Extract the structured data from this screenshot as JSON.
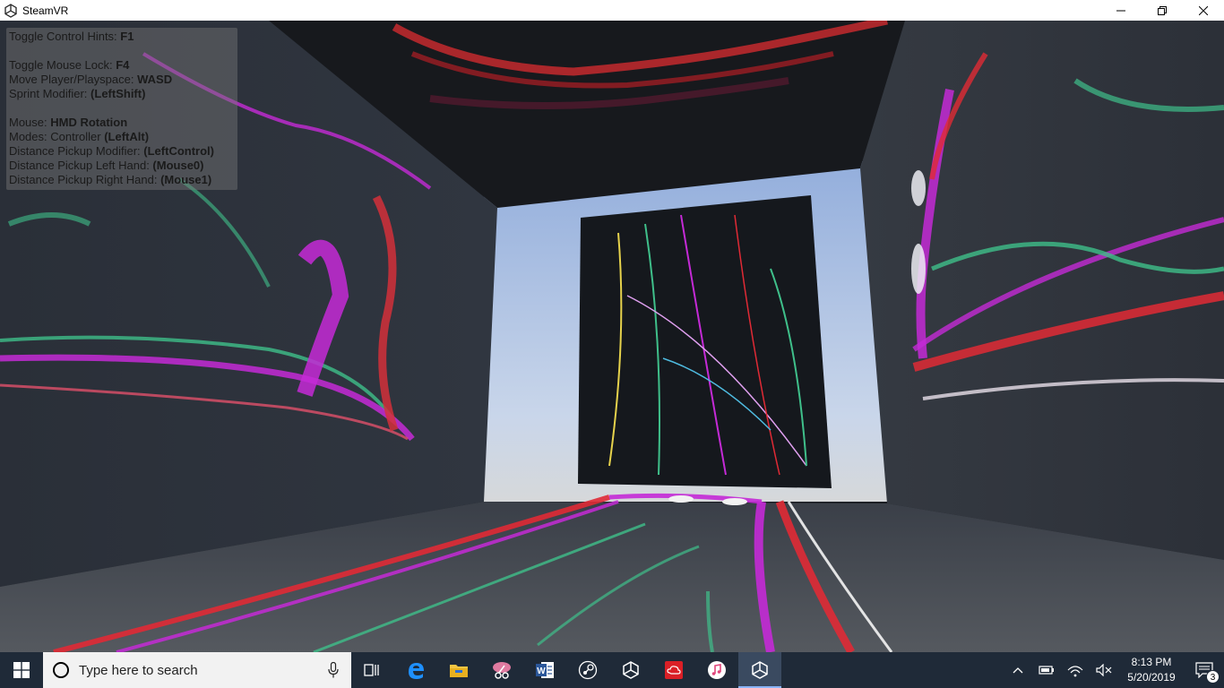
{
  "window": {
    "title": "SteamVR"
  },
  "hints": {
    "lines": [
      {
        "label": "Toggle Control Hints: ",
        "key": "F1"
      },
      {
        "label": "Toggle Mouse Lock: ",
        "key": "F4"
      },
      {
        "label": "Move Player/Playspace: ",
        "key": "WASD"
      },
      {
        "label": "Sprint Modifier: ",
        "key": "(LeftShift)"
      },
      {
        "label": "Mouse: ",
        "key": "HMD Rotation"
      },
      {
        "label": "Modes: Controller ",
        "key": "(LeftAlt)"
      },
      {
        "label": "Distance Pickup Modifier: ",
        "key": "(LeftControl)"
      },
      {
        "label": "Distance Pickup Left Hand: ",
        "key": "(Mouse0)"
      },
      {
        "label": "Distance Pickup Right Hand: ",
        "key": "(Mouse1)"
      }
    ]
  },
  "taskbar": {
    "search_placeholder": "Type here to search",
    "apps": [
      "task-view-icon",
      "edge-icon",
      "file-explorer-icon",
      "snipping-tool-icon",
      "word-icon",
      "steam-icon",
      "unity-icon",
      "creative-cloud-icon",
      "itunes-icon",
      "unity-active-icon"
    ],
    "clock_time": "8:13 PM",
    "clock_date": "5/20/2019",
    "notification_count": "3"
  },
  "colors": {
    "taskbar": "#1f2a38",
    "accent": "#8ab4f8"
  }
}
